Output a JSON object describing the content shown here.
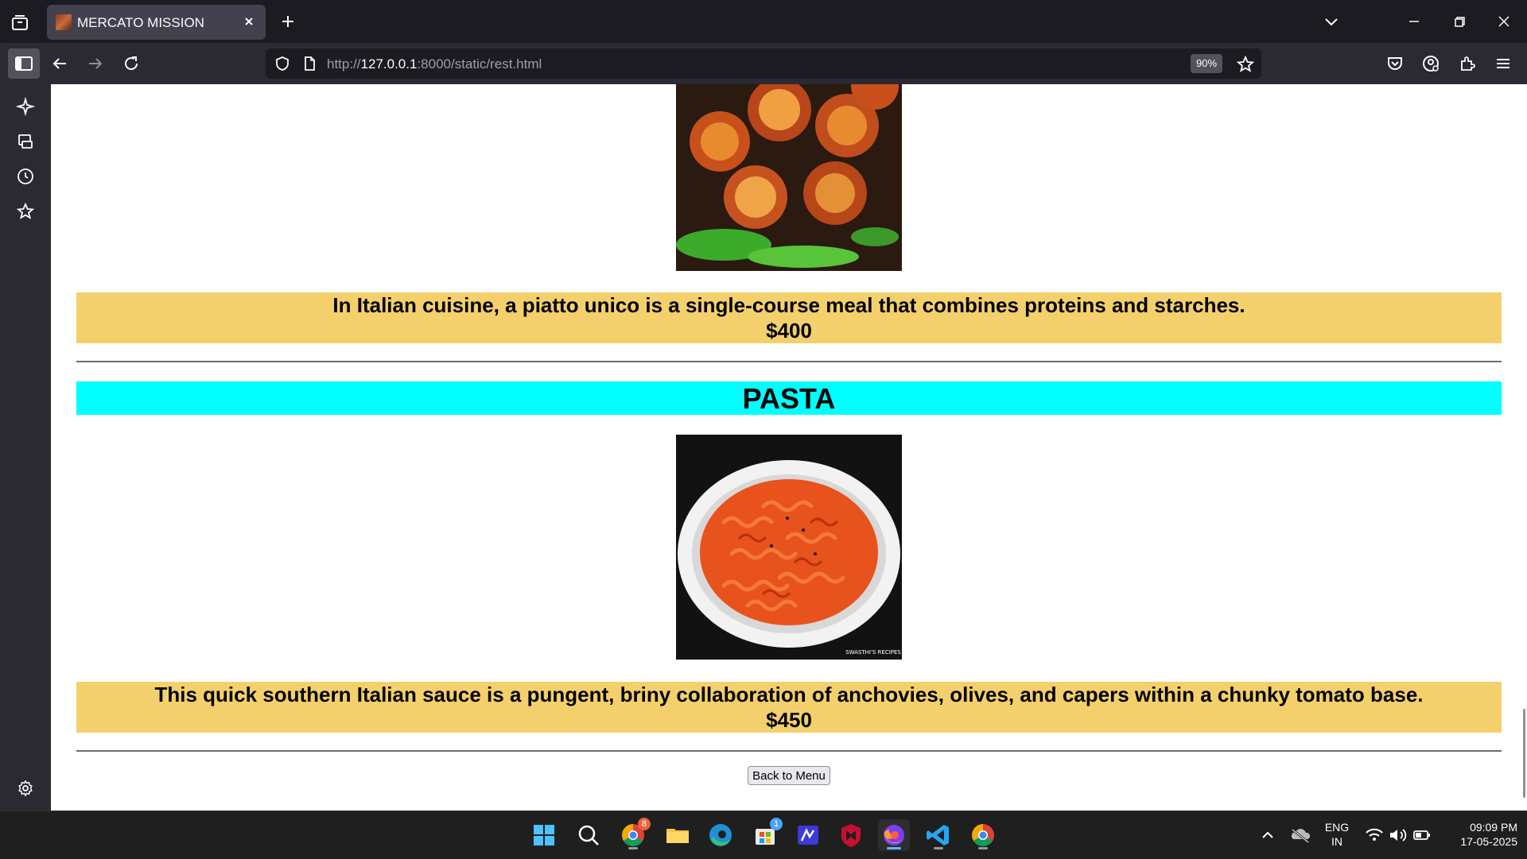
{
  "browser": {
    "tab": {
      "title": "MERCATO MISSION"
    },
    "url": {
      "prefix": "http://",
      "host": "127.0.0.1",
      "rest": ":8000/static/rest.html"
    },
    "zoom": "90%"
  },
  "page": {
    "items": [
      {
        "description": "In Italian cuisine, a piatto unico is a single-course meal that combines proteins and starches.",
        "price": "$400"
      },
      {
        "heading": "PASTA",
        "description": "This quick southern Italian sauce is a pungent, briny collaboration of anchovies, olives, and capers within a chunky tomato base.",
        "price": "$450",
        "image_watermark": "SWASTHI'S RECIPES"
      }
    ],
    "back_button": "Back to Menu"
  },
  "taskbar": {
    "language": {
      "line1": "ENG",
      "line2": "IN"
    },
    "clock": {
      "time": "09:09 PM",
      "date": "17-05-2025"
    },
    "badges": {
      "chrome_notifications": "8",
      "store_notifications": "1"
    }
  },
  "colors": {
    "description_bg": "#f4d06c",
    "section_heading_bg": "#00ffff",
    "browser_chrome": "#2b2a33",
    "tabstrip": "#1c1b22"
  }
}
